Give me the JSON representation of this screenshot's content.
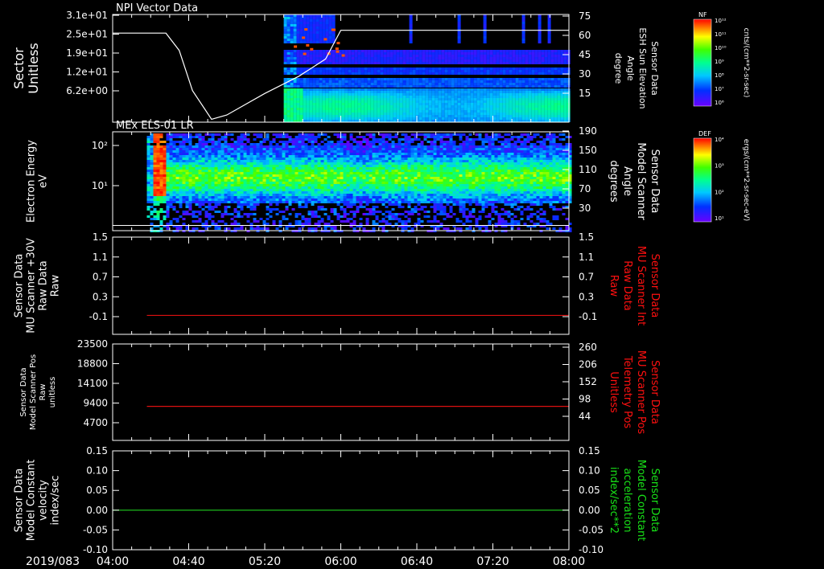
{
  "chart_data": {
    "type": "line",
    "x_range": [
      "2019/083 04:00",
      "2019/083 08:00"
    ],
    "date_label": "2019/083",
    "x_ticks": [
      "04:00",
      "04:40",
      "05:20",
      "06:00",
      "06:40",
      "07:20",
      "08:00"
    ],
    "x_minutes": [
      0,
      40,
      80,
      120,
      160,
      200,
      240
    ],
    "panels": [
      {
        "id": "npi",
        "type": "heatmap",
        "title": "NPI Vector Data",
        "left_label": [
          "Sector",
          "Unitless"
        ],
        "left_ticks": [
          "3.1e+01",
          "2.5e+01",
          "1.9e+01",
          "1.2e+01",
          "6.2e+00"
        ],
        "right_label": [
          "Sensor Data",
          "ESH Sun Elevation",
          "Angle",
          "degree"
        ],
        "right_ticks": [
          "75",
          "60",
          "45",
          "30",
          "15"
        ],
        "right_range": [
          0,
          75
        ],
        "line_series": {
          "name": "ESH Sun Elevation Angle",
          "color": "#ffffff",
          "points": [
            [
              0,
              62
            ],
            [
              28,
              62
            ],
            [
              35,
              50
            ],
            [
              42,
              22
            ],
            [
              52,
              2
            ],
            [
              60,
              5
            ],
            [
              80,
              20
            ],
            [
              98,
              32
            ],
            [
              112,
              44
            ],
            [
              120,
              64
            ],
            [
              240,
              64
            ]
          ]
        },
        "colorbar": {
          "title": "NF",
          "units": "cnts/(cm**2-sr-sec)",
          "ticks": [
            "10¹²",
            "10¹¹",
            "10¹⁰",
            "10⁹",
            "10⁸",
            "10⁷",
            "10⁶"
          ]
        }
      },
      {
        "id": "els",
        "type": "heatmap",
        "title": "MEx ELS-01 LR",
        "left_label": [
          "Electron Energy",
          "eV"
        ],
        "left_ticks": [
          "10²",
          "10¹"
        ],
        "right_label": [
          "Sensor Data",
          "Model Scanner",
          "Angle",
          "degrees"
        ],
        "right_ticks": [
          "190",
          "150",
          "110",
          "70",
          "30"
        ],
        "right_range": [
          0,
          190
        ],
        "line_series": {
          "name": "Model Scanner Angle",
          "color": "#ffffff",
          "constant": 10
        },
        "colorbar": {
          "title": "DEF",
          "units": "ergs/(cm**2-sr-sec-eV)",
          "ticks": [
            "10⁴",
            "10³",
            "10²",
            "10¹"
          ]
        }
      },
      {
        "id": "mu_int",
        "type": "line",
        "left_label": [
          "Sensor Data",
          "MU Scanner +30V",
          "Raw Data",
          "Raw"
        ],
        "left_ticks": [
          "1.5",
          "1.1",
          "0.7",
          "0.3",
          "-0.1"
        ],
        "right_label": [
          "Sensor Data",
          "MU Scanner Int",
          "Raw Data",
          "Raw"
        ],
        "right_label_color": "#ff1010",
        "right_ticks": [
          "1.5",
          "1.1",
          "0.7",
          "0.3",
          "-0.1"
        ],
        "ylim": [
          -0.4,
          1.5
        ],
        "series": [
          {
            "name": "MU Scanner Int Raw Data",
            "color": "#dd1010",
            "x_start": 18,
            "x_end": 240,
            "value": -0.03
          }
        ]
      },
      {
        "id": "mu_pos",
        "type": "line",
        "left_label": [
          "Sensor Data",
          "Model Scanner Pos",
          "Raw",
          "unitless"
        ],
        "left_ticks": [
          "23500",
          "18800",
          "14100",
          "9400",
          "4700"
        ],
        "right_label": [
          "Sensor Data",
          "MU Scanner Pos",
          "Telemetry Pos",
          "Unitless"
        ],
        "right_label_color": "#ff1010",
        "right_ticks": [
          "260",
          "206",
          "152",
          "98",
          "44"
        ],
        "ylim": [
          0,
          23500
        ],
        "series": [
          {
            "name": "MU Scanner Pos Telemetry Pos",
            "color": "#dd1010",
            "x_start": 18,
            "x_end": 240,
            "value": 8300
          }
        ]
      },
      {
        "id": "model_const",
        "type": "line",
        "left_label": [
          "Sensor Data",
          "Model Constant",
          "velocity",
          "index/sec"
        ],
        "left_ticks": [
          "0.15",
          "0.10",
          "0.05",
          "0.00",
          "-0.05",
          "-0.10"
        ],
        "right_label": [
          "Sensor Data",
          "Model Constant",
          "acceleration",
          "index/sec**2"
        ],
        "right_label_color": "#18e018",
        "right_ticks": [
          "0.15",
          "0.10",
          "0.05",
          "0.00",
          "-0.05",
          "-0.10"
        ],
        "ylim": [
          -0.1,
          0.15
        ],
        "series": [
          {
            "name": "Model Constant acceleration",
            "color": "#20d020",
            "x_start": 0,
            "x_end": 240,
            "value": 0.0
          }
        ]
      }
    ]
  }
}
